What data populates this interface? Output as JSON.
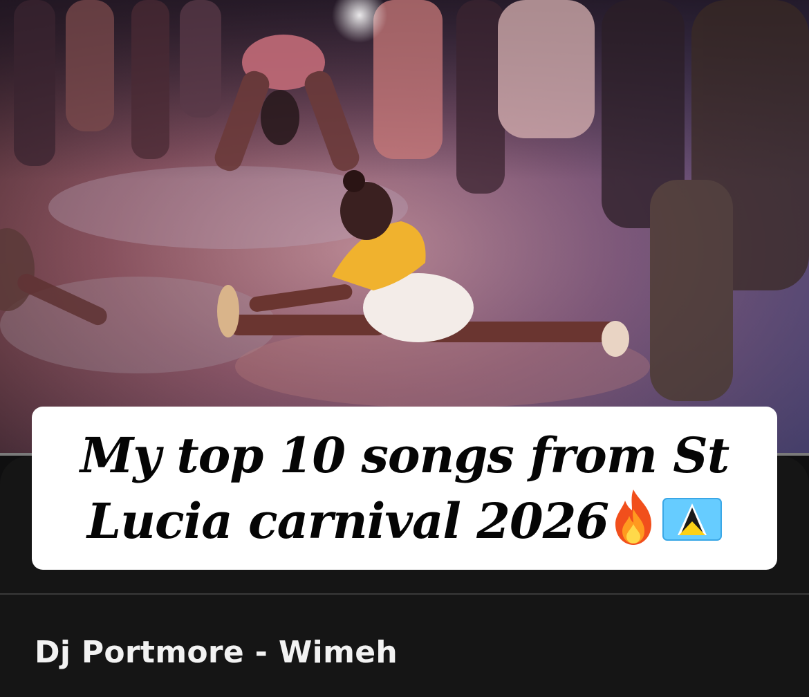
{
  "video": {
    "caption_line1": "My top 10 songs from St",
    "caption_line2": "Lucia carnival 2026",
    "caption_emojis": [
      "fire-icon",
      "saint-lucia-flag-icon"
    ]
  },
  "now_playing": {
    "track_label": "Dj Portmore - Wimeh"
  },
  "colors": {
    "panel_bg": "#151515",
    "caption_bg": "#ffffff",
    "caption_text": "#050505",
    "flag_blue": "#66CCFF",
    "flag_yellow": "#FCD116"
  }
}
